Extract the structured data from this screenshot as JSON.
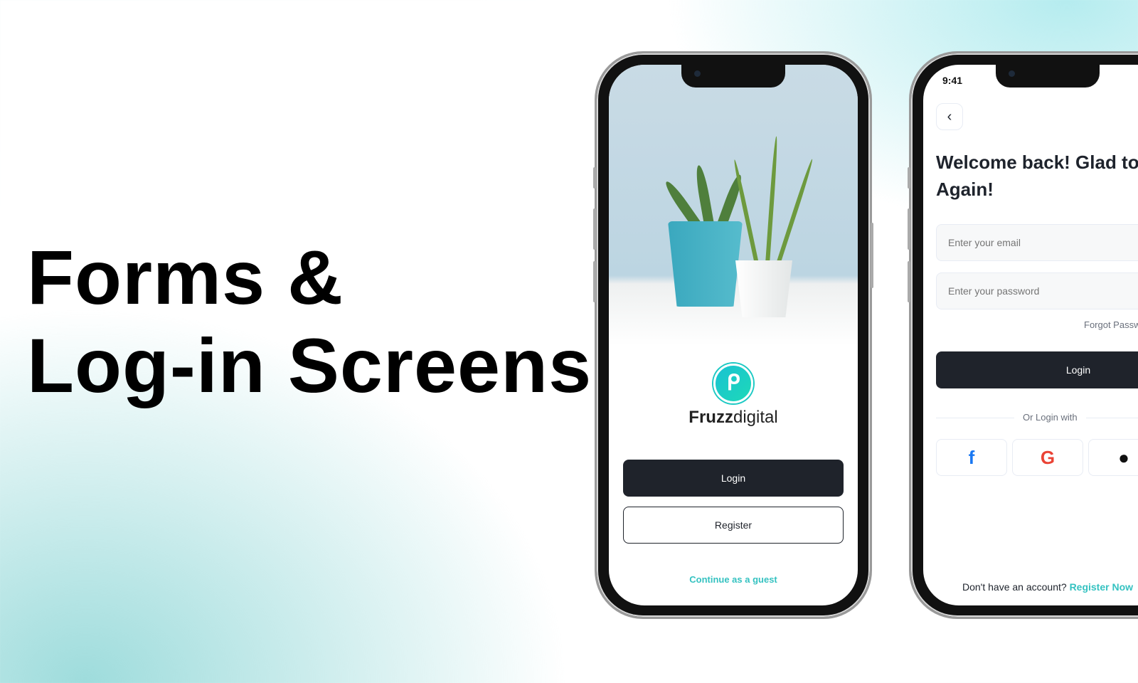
{
  "headline": {
    "line1": "Forms &",
    "line2": "Log-in Screens"
  },
  "phone1": {
    "brand_bold": "Fruzz",
    "brand_light": "digital",
    "login": "Login",
    "register": "Register",
    "guest": "Continue as a guest"
  },
  "phone2": {
    "time": "9:41",
    "title": "Welcome back! Glad to see you, Again!",
    "email_placeholder": "Enter your email",
    "password_placeholder": "Enter your password",
    "forgot": "Forgot Password?",
    "login": "Login",
    "or_login": "Or Login with",
    "signup_prompt": "Don't have an account?",
    "signup_link": "Register Now"
  },
  "colors": {
    "accent": "#35c2c1",
    "dark_button": "#1f232b",
    "facebook": "#1877f2"
  }
}
